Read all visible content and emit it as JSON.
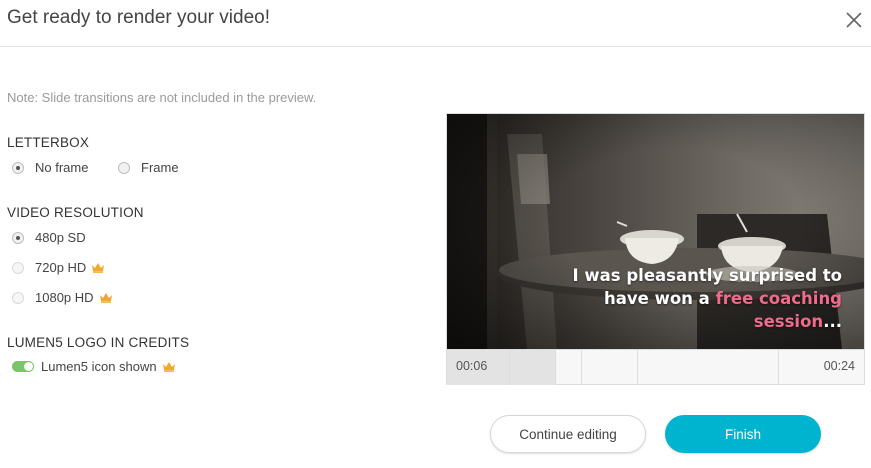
{
  "dialog": {
    "title": "Get ready to render your video!"
  },
  "note": "Note: Slide transitions are not included in the preview.",
  "letterbox": {
    "label": "LETTERBOX",
    "options": [
      {
        "label": "No frame",
        "selected": true
      },
      {
        "label": "Frame",
        "selected": false
      }
    ]
  },
  "resolution": {
    "label": "VIDEO RESOLUTION",
    "options": [
      {
        "label": "480p SD",
        "selected": true,
        "premium": false
      },
      {
        "label": "720p HD",
        "selected": false,
        "premium": true
      },
      {
        "label": "1080p HD",
        "selected": false,
        "premium": true
      }
    ]
  },
  "logo_credits": {
    "label": "LUMEN5 LOGO IN CREDITS",
    "toggle_label": "Lumen5 icon shown",
    "enabled": true,
    "premium": true
  },
  "preview": {
    "caption_lines": [
      "I was pleasantly surprised to",
      "have won a "
    ],
    "caption_highlight": "free coaching",
    "caption_last": "session",
    "caption_ellipsis": "...",
    "time_current": "00:06",
    "time_total": "00:24"
  },
  "buttons": {
    "continue": "Continue editing",
    "finish": "Finish"
  },
  "colors": {
    "accent": "#00b4d0",
    "toggle_on": "#7cc36a",
    "premium_crown": "#f0a92e",
    "caption_highlight": "#ee6b8c"
  }
}
